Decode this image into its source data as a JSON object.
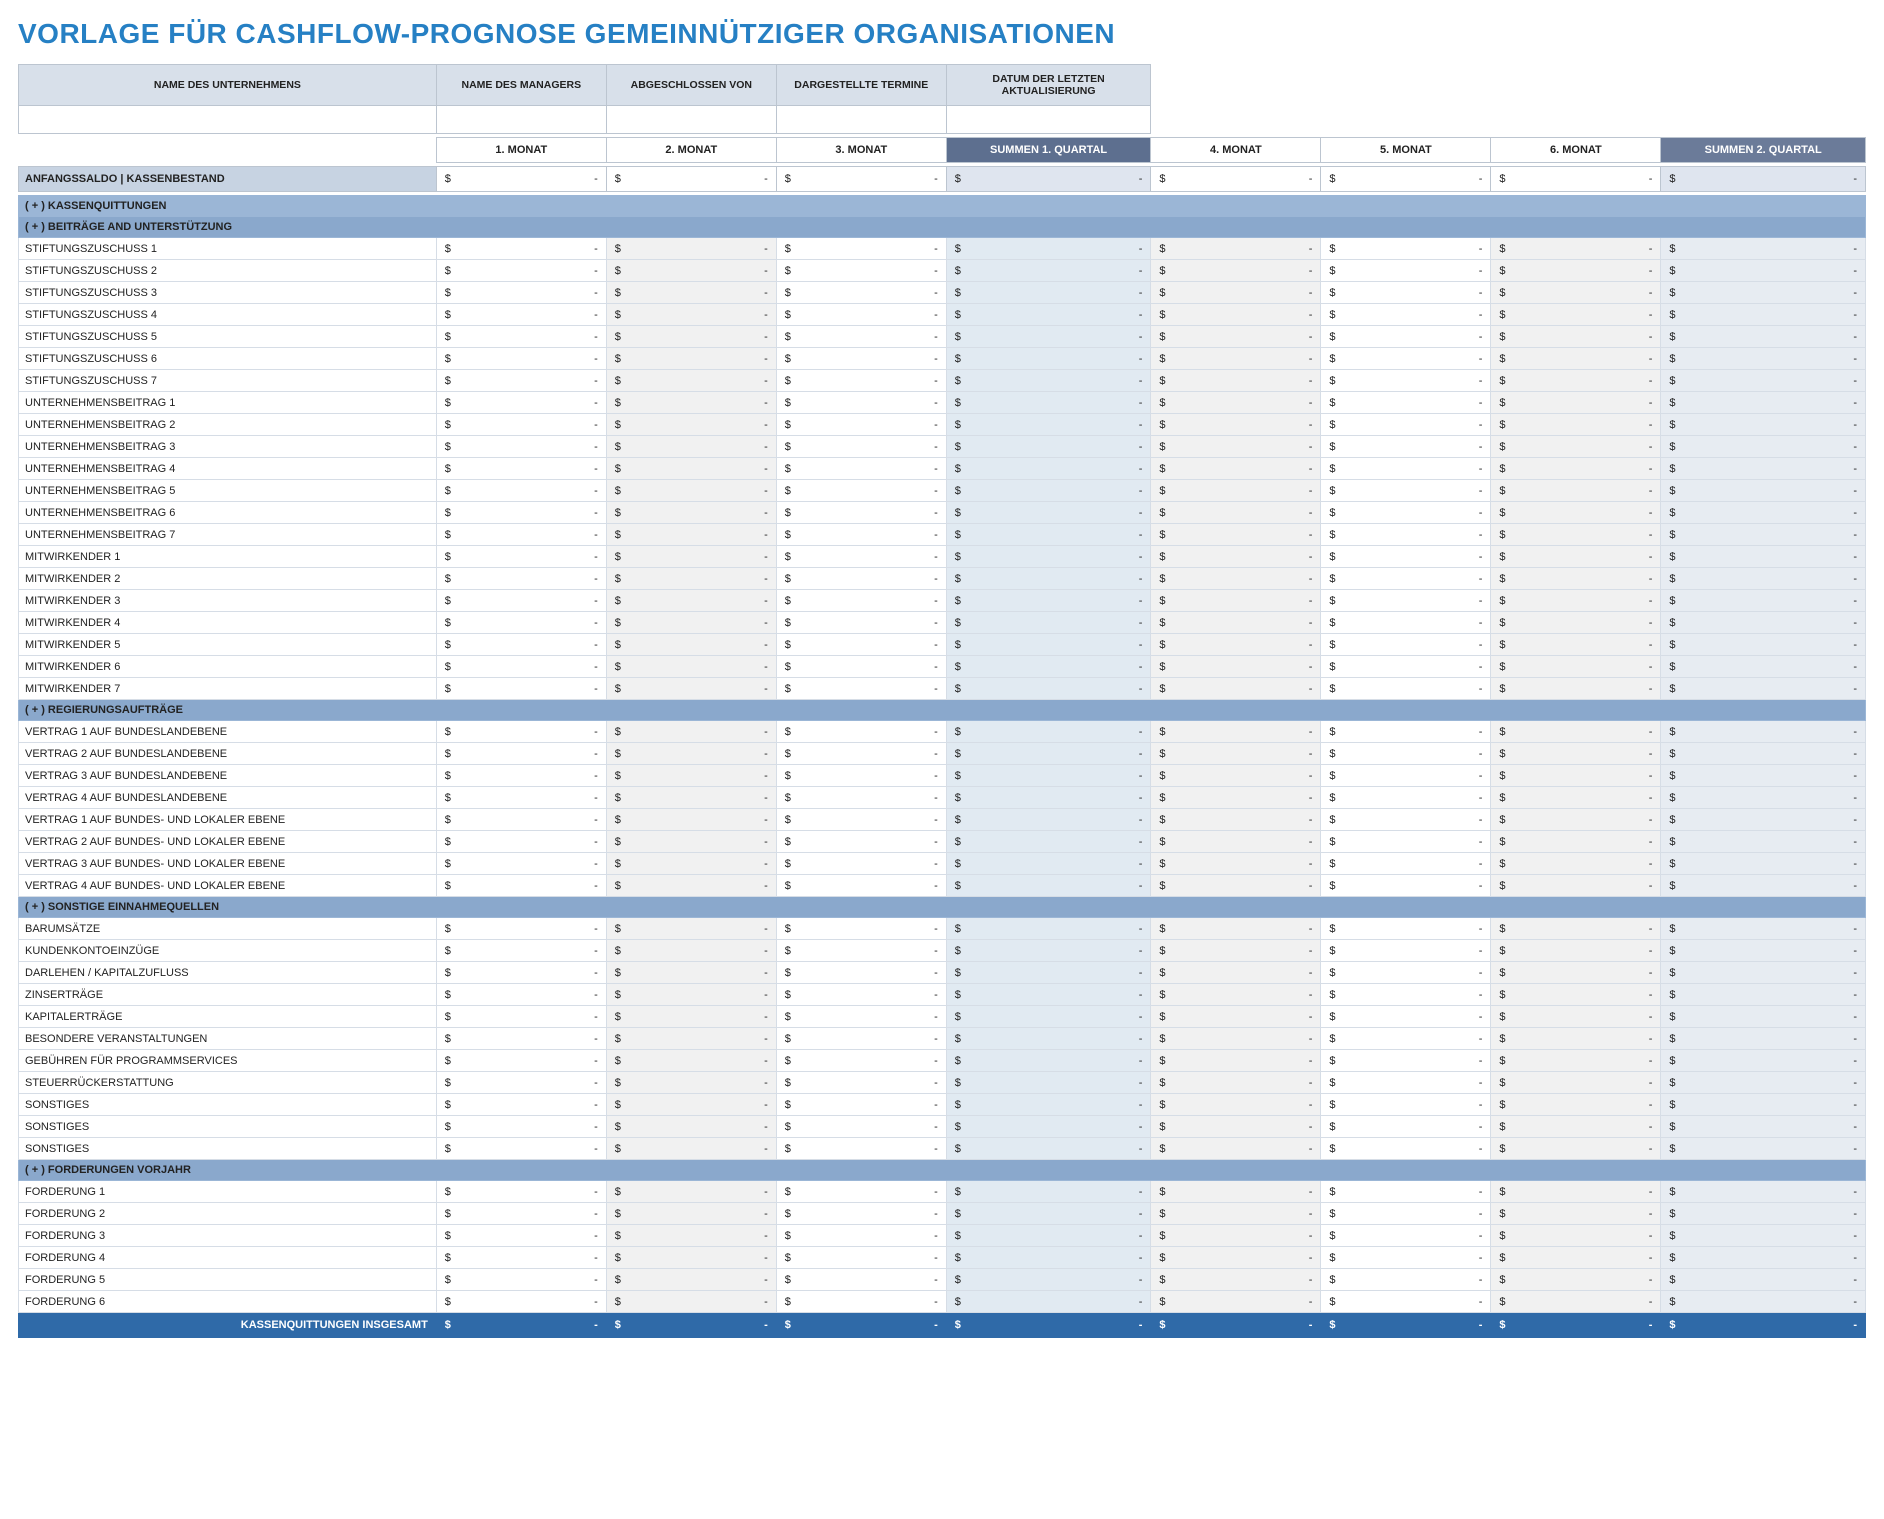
{
  "title": "VORLAGE FÜR CASHFLOW-PROGNOSE GEMEINNÜTZIGER ORGANISATIONEN",
  "info_headers": [
    "NAME DES UNTERNEHMENS",
    "NAME DES MANAGERS",
    "ABGESCHLOSSEN VON",
    "DARGESTELLTE TERMINE",
    "DATUM DER LETZTEN AKTUALISIERUNG"
  ],
  "info_values": [
    "",
    "",
    "",
    "",
    ""
  ],
  "month_headers": [
    "1. MONAT",
    "2. MONAT",
    "3. MONAT",
    "SUMMEN 1. QUARTAL",
    "4. MONAT",
    "5. MONAT",
    "6. MONAT",
    "SUMMEN 2. QUARTAL"
  ],
  "balance_label": "ANFANGSSALDO | KASSENBESTAND",
  "currency": "$",
  "dash": "-",
  "sections": [
    {
      "dark": false,
      "title": "( + ) KASSENQUITTUNGEN",
      "rows": []
    },
    {
      "dark": true,
      "title": "( + ) BEITRÄGE AND UNTERSTÜTZUNG",
      "rows": [
        "STIFTUNGSZUSCHUSS 1",
        "STIFTUNGSZUSCHUSS 2",
        "STIFTUNGSZUSCHUSS 3",
        "STIFTUNGSZUSCHUSS 4",
        "STIFTUNGSZUSCHUSS 5",
        "STIFTUNGSZUSCHUSS 6",
        "STIFTUNGSZUSCHUSS 7",
        "UNTERNEHMENSBEITRAG 1",
        "UNTERNEHMENSBEITRAG 2",
        "UNTERNEHMENSBEITRAG 3",
        "UNTERNEHMENSBEITRAG 4",
        "UNTERNEHMENSBEITRAG 5",
        "UNTERNEHMENSBEITRAG 6",
        "UNTERNEHMENSBEITRAG 7",
        "MITWIRKENDER 1",
        "MITWIRKENDER 2",
        "MITWIRKENDER 3",
        "MITWIRKENDER 4",
        "MITWIRKENDER 5",
        "MITWIRKENDER 6",
        "MITWIRKENDER 7"
      ]
    },
    {
      "dark": true,
      "title": "( + ) REGIERUNGSAUFTRÄGE",
      "rows": [
        "VERTRAG 1 AUF BUNDESLANDEBENE",
        "VERTRAG 2 AUF BUNDESLANDEBENE",
        "VERTRAG 3 AUF BUNDESLANDEBENE",
        "VERTRAG 4 AUF BUNDESLANDEBENE",
        "VERTRAG 1 AUF BUNDES- UND LOKALER EBENE",
        "VERTRAG 2 AUF BUNDES- UND LOKALER EBENE",
        "VERTRAG 3 AUF BUNDES- UND LOKALER EBENE",
        "VERTRAG 4 AUF BUNDES- UND LOKALER EBENE"
      ]
    },
    {
      "dark": true,
      "title": "( + ) SONSTIGE EINNAHMEQUELLEN",
      "rows": [
        "BARUMSÄTZE",
        "KUNDENKONTOEINZÜGE",
        "DARLEHEN / KAPITALZUFLUSS",
        "ZINSERTRÄGE",
        "KAPITALERTRÄGE",
        "BESONDERE VERANSTALTUNGEN",
        "GEBÜHREN FÜR PROGRAMMSERVICES",
        "STEUERRÜCKERSTATTUNG",
        "SONSTIGES",
        "SONSTIGES",
        "SONSTIGES"
      ]
    },
    {
      "dark": true,
      "title": "( + ) FORDERUNGEN VORJAHR",
      "rows": [
        "FORDERUNG 1",
        "FORDERUNG 2",
        "FORDERUNG 3",
        "FORDERUNG 4",
        "FORDERUNG 5",
        "FORDERUNG 6"
      ]
    }
  ],
  "total_label": "KASSENQUITTUNGEN INSGESAMT"
}
